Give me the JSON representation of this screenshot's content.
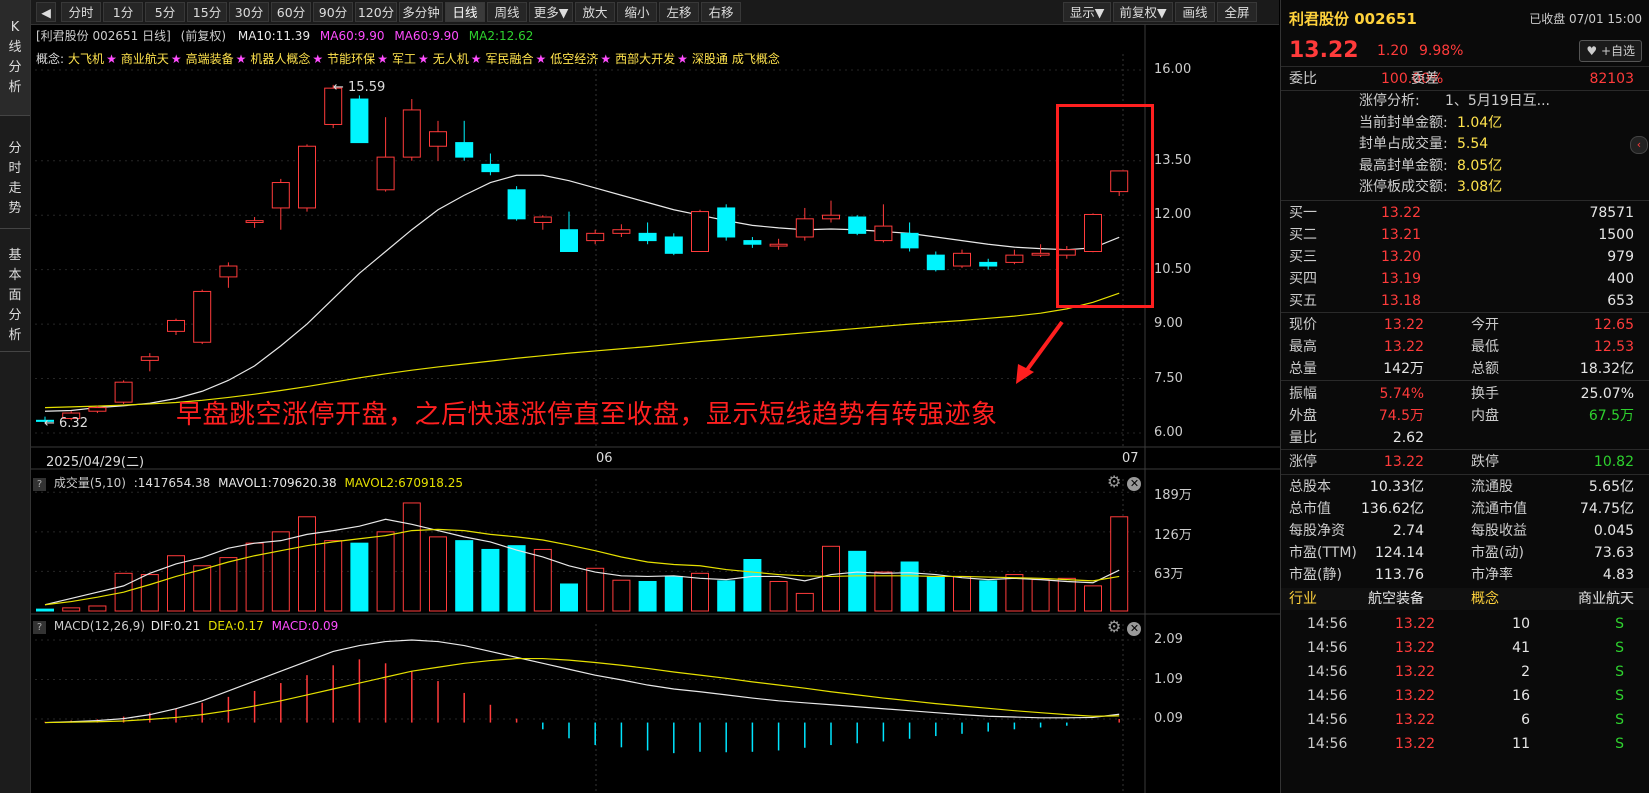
{
  "left_nav": [
    {
      "label": "K线分析"
    },
    {
      "label": "分时走势"
    },
    {
      "label": "基本面分析"
    }
  ],
  "toolbar": {
    "back_icon": "chevron-left-icon",
    "periods": [
      "分时",
      "1分",
      "5分",
      "15分",
      "30分",
      "60分",
      "90分",
      "120分",
      "多分钟",
      "日线",
      "周线",
      "更多▼"
    ],
    "active_period": "日线",
    "actions": [
      "放大",
      "缩小",
      "左移",
      "右移"
    ],
    "right_actions": [
      "显示▼",
      "前复权▼",
      "画线",
      "全屏"
    ]
  },
  "chart_header": {
    "stock_tag": "[利君股份 002651 日线]",
    "adj": "(前复权)",
    "ma10": "MA10:11.39",
    "ma60a": "MA60:9.90",
    "ma60b": "MA60:9.90",
    "ma2": "MA2:12.62"
  },
  "concepts": {
    "label": "概念:",
    "items": [
      "大飞机",
      "商业航天",
      "高端装备",
      "机器人概念",
      "节能环保",
      "军工",
      "无人机",
      "军民融合",
      "低空经济",
      "西部大开发",
      "深股通",
      "成飞概念"
    ],
    "star": "★"
  },
  "colors": {
    "up": "#ff3b3b",
    "down": "#00f5ff",
    "ma1": "#e8e8e8",
    "ma2": "#e5e000",
    "annotation": "#ff2020",
    "macd_neg": "#00e5ff"
  },
  "annotation": {
    "text": "早盘跳空涨停开盘，之后快速涨停直至收盘，显示短线趋势有转强迹象",
    "high_label": "15.59",
    "low_label": "6.32"
  },
  "volume_header": {
    "name": "成交量(5,10)",
    "vol": ":1417654.38",
    "mavol1": "MAVOL1:709620.38",
    "mavol2": "MAVOL2:670918.25"
  },
  "macd_header": {
    "name": "MACD(12,26,9)",
    "dif": "DIF:0.21",
    "dea": "DEA:0.17",
    "macd": "MACD:0.09"
  },
  "gear_icon": "gear-icon",
  "close_icon": "close-icon",
  "chart_data": [
    {
      "type": "candlestick",
      "title": "利君股份 002651 日线",
      "y_ticks": [
        "16.00",
        "13.50",
        "12.00",
        "10.50",
        "9.00",
        "7.50",
        "6.00"
      ],
      "x_labels": [
        "2025/04/29(二)",
        "06",
        "07"
      ],
      "ylim": [
        5.9,
        16.2
      ],
      "candles": [
        {
          "o": 6.35,
          "c": 6.32,
          "h": 6.45,
          "l": 6.3
        },
        {
          "o": 6.4,
          "c": 6.55,
          "h": 6.6,
          "l": 6.35
        },
        {
          "o": 6.6,
          "c": 6.7,
          "h": 6.75,
          "l": 6.55
        },
        {
          "o": 6.85,
          "c": 7.4,
          "h": 7.45,
          "l": 6.8
        },
        {
          "o": 8.0,
          "c": 8.1,
          "h": 8.2,
          "l": 7.7
        },
        {
          "o": 8.8,
          "c": 9.1,
          "h": 9.15,
          "l": 8.7
        },
        {
          "o": 8.5,
          "c": 9.9,
          "h": 9.95,
          "l": 8.45
        },
        {
          "o": 10.3,
          "c": 10.6,
          "h": 10.7,
          "l": 10.0
        },
        {
          "o": 11.8,
          "c": 11.85,
          "h": 11.95,
          "l": 11.65
        },
        {
          "o": 12.2,
          "c": 12.9,
          "h": 13.0,
          "l": 11.6
        },
        {
          "o": 12.2,
          "c": 13.9,
          "h": 13.95,
          "l": 12.1
        },
        {
          "o": 14.5,
          "c": 15.5,
          "h": 15.59,
          "l": 14.4
        },
        {
          "o": 15.2,
          "c": 14.0,
          "h": 15.3,
          "l": 14.0
        },
        {
          "o": 12.7,
          "c": 13.6,
          "h": 14.7,
          "l": 12.65
        },
        {
          "o": 13.6,
          "c": 14.9,
          "h": 15.2,
          "l": 13.5
        },
        {
          "o": 13.9,
          "c": 14.3,
          "h": 14.6,
          "l": 13.5
        },
        {
          "o": 14.0,
          "c": 13.6,
          "h": 14.6,
          "l": 13.5
        },
        {
          "o": 13.4,
          "c": 13.2,
          "h": 13.7,
          "l": 13.1
        },
        {
          "o": 12.7,
          "c": 11.9,
          "h": 12.8,
          "l": 11.85
        },
        {
          "o": 11.8,
          "c": 11.95,
          "h": 12.0,
          "l": 11.6
        },
        {
          "o": 11.6,
          "c": 11.0,
          "h": 12.1,
          "l": 11.0
        },
        {
          "o": 11.3,
          "c": 11.5,
          "h": 11.6,
          "l": 11.2
        },
        {
          "o": 11.5,
          "c": 11.6,
          "h": 11.75,
          "l": 11.4
        },
        {
          "o": 11.5,
          "c": 11.3,
          "h": 11.8,
          "l": 11.2
        },
        {
          "o": 11.4,
          "c": 10.95,
          "h": 11.5,
          "l": 10.9
        },
        {
          "o": 11.0,
          "c": 12.1,
          "h": 12.15,
          "l": 11.0
        },
        {
          "o": 12.2,
          "c": 11.4,
          "h": 12.3,
          "l": 11.3
        },
        {
          "o": 11.3,
          "c": 11.2,
          "h": 11.4,
          "l": 11.1
        },
        {
          "o": 11.15,
          "c": 11.2,
          "h": 11.35,
          "l": 11.05
        },
        {
          "o": 11.4,
          "c": 11.9,
          "h": 12.2,
          "l": 11.3
        },
        {
          "o": 11.9,
          "c": 12.0,
          "h": 12.4,
          "l": 11.8
        },
        {
          "o": 11.95,
          "c": 11.5,
          "h": 12.0,
          "l": 11.45
        },
        {
          "o": 11.3,
          "c": 11.7,
          "h": 12.3,
          "l": 11.25
        },
        {
          "o": 11.5,
          "c": 11.1,
          "h": 11.8,
          "l": 11.0
        },
        {
          "o": 10.9,
          "c": 10.5,
          "h": 11.0,
          "l": 10.45
        },
        {
          "o": 10.6,
          "c": 10.95,
          "h": 11.05,
          "l": 10.55
        },
        {
          "o": 10.7,
          "c": 10.6,
          "h": 10.8,
          "l": 10.5
        },
        {
          "o": 10.7,
          "c": 10.9,
          "h": 11.05,
          "l": 10.65
        },
        {
          "o": 10.9,
          "c": 10.95,
          "h": 11.2,
          "l": 10.85
        },
        {
          "o": 10.9,
          "c": 11.05,
          "h": 11.15,
          "l": 10.8
        },
        {
          "o": 11.0,
          "c": 12.02,
          "h": 12.05,
          "l": 10.98
        },
        {
          "o": 12.65,
          "c": 13.22,
          "h": 13.22,
          "l": 12.53
        }
      ],
      "ma_white": [
        6.6,
        6.62,
        6.7,
        6.75,
        6.82,
        6.95,
        7.15,
        7.45,
        7.85,
        8.4,
        9.0,
        9.7,
        10.4,
        11.0,
        11.6,
        12.15,
        12.55,
        12.9,
        13.1,
        13.1,
        12.95,
        12.75,
        12.55,
        12.35,
        12.15,
        12.0,
        11.85,
        11.72,
        11.65,
        11.6,
        11.62,
        11.6,
        11.55,
        11.5,
        11.4,
        11.3,
        11.2,
        11.12,
        11.08,
        11.05,
        11.1,
        11.39
      ],
      "ma_yellow": [
        6.7,
        6.72,
        6.74,
        6.77,
        6.8,
        6.84,
        6.9,
        6.98,
        7.07,
        7.17,
        7.28,
        7.4,
        7.52,
        7.63,
        7.73,
        7.82,
        7.9,
        7.98,
        8.06,
        8.13,
        8.2,
        8.26,
        8.32,
        8.38,
        8.45,
        8.52,
        8.58,
        8.64,
        8.7,
        8.76,
        8.82,
        8.88,
        8.94,
        9.0,
        9.05,
        9.1,
        9.16,
        9.22,
        9.3,
        9.42,
        9.6,
        9.85
      ]
    },
    {
      "type": "bar",
      "title": "成交量(5,10)",
      "y_ticks": [
        "189万",
        "126万",
        "63万"
      ],
      "ylim": [
        0,
        199
      ],
      "values": [
        3,
        5,
        8,
        60,
        58,
        88,
        72,
        85,
        108,
        126,
        150,
        112,
        108,
        126,
        172,
        118,
        112,
        98,
        104,
        98,
        43,
        68,
        49,
        47,
        55,
        60,
        48,
        82,
        47,
        28,
        103,
        95,
        62,
        78,
        55,
        55,
        48,
        58,
        50,
        52,
        40,
        150
      ],
      "mavol1": [
        10,
        20,
        30,
        40,
        60,
        75,
        85,
        100,
        108,
        112,
        122,
        128,
        135,
        146,
        138,
        128,
        118,
        110,
        97,
        86,
        72,
        62,
        56,
        55,
        56,
        52,
        50,
        55,
        55,
        48,
        58,
        62,
        60,
        61,
        58,
        53,
        50,
        52,
        50,
        47,
        45,
        65
      ],
      "mavol2": [
        10,
        15,
        22,
        30,
        42,
        55,
        66,
        78,
        88,
        96,
        104,
        110,
        115,
        120,
        128,
        130,
        128,
        122,
        118,
        113,
        105,
        96,
        86,
        78,
        74,
        72,
        66,
        62,
        58,
        56,
        55,
        56,
        56,
        56,
        55,
        55,
        54,
        53,
        52,
        50,
        48,
        55
      ]
    },
    {
      "type": "bar",
      "title": "MACD(12,26,9)",
      "y_ticks": [
        "2.09",
        "1.09",
        "0.09"
      ],
      "ylim": [
        -1.2,
        2.3
      ],
      "macd": [
        0.02,
        0.05,
        0.08,
        0.15,
        0.25,
        0.35,
        0.5,
        0.65,
        0.8,
        1.0,
        1.2,
        1.45,
        1.6,
        1.5,
        1.3,
        1.05,
        0.75,
        0.45,
        0.1,
        -0.15,
        -0.35,
        -0.5,
        -0.55,
        -0.62,
        -0.68,
        -0.65,
        -0.66,
        -0.65,
        -0.62,
        -0.56,
        -0.5,
        -0.46,
        -0.42,
        -0.36,
        -0.3,
        -0.25,
        -0.2,
        -0.15,
        -0.11,
        -0.07,
        0.0,
        0.09
      ],
      "dif": [
        0.0,
        0.02,
        0.05,
        0.1,
        0.2,
        0.35,
        0.55,
        0.8,
        1.05,
        1.3,
        1.55,
        1.8,
        1.95,
        2.05,
        2.09,
        2.05,
        1.95,
        1.8,
        1.65,
        1.5,
        1.35,
        1.2,
        1.08,
        0.95,
        0.85,
        0.78,
        0.7,
        0.62,
        0.55,
        0.5,
        0.45,
        0.4,
        0.35,
        0.3,
        0.25,
        0.2,
        0.16,
        0.14,
        0.12,
        0.12,
        0.13,
        0.21
      ],
      "dea": [
        0.0,
        0.01,
        0.02,
        0.04,
        0.08,
        0.13,
        0.2,
        0.3,
        0.42,
        0.55,
        0.7,
        0.85,
        1.0,
        1.15,
        1.3,
        1.4,
        1.5,
        1.57,
        1.62,
        1.62,
        1.58,
        1.52,
        1.45,
        1.37,
        1.28,
        1.2,
        1.12,
        1.03,
        0.95,
        0.87,
        0.78,
        0.7,
        0.62,
        0.55,
        0.48,
        0.42,
        0.36,
        0.3,
        0.25,
        0.2,
        0.16,
        0.17
      ]
    }
  ],
  "quote": {
    "name_code": "利君股份 002651",
    "status": "已收盘 07/01 15:00",
    "price": "13.22",
    "change": "1.20",
    "pct": "9.98%",
    "watch_label": "+自选",
    "weibi_label": "委比",
    "weibi": "100.00%",
    "weicha_label": "委差",
    "weicha": "82103",
    "limit": [
      {
        "k": "涨停分析:",
        "v": "1、5月19日互..."
      },
      {
        "k": "当前封单金额:",
        "v": "1.04亿"
      },
      {
        "k": "封单占成交量:",
        "v": "5.54"
      },
      {
        "k": "最高封单金额:",
        "v": "8.05亿"
      },
      {
        "k": "涨停板成交额:",
        "v": "3.08亿"
      }
    ],
    "bids": [
      {
        "k": "买一",
        "p": "13.22",
        "v": "78571"
      },
      {
        "k": "买二",
        "p": "13.21",
        "v": "1500"
      },
      {
        "k": "买三",
        "p": "13.20",
        "v": "979"
      },
      {
        "k": "买四",
        "p": "13.19",
        "v": "400"
      },
      {
        "k": "买五",
        "p": "13.18",
        "v": "653"
      }
    ],
    "stats1": [
      {
        "k1": "现价",
        "v1": "13.22",
        "c1": "red",
        "k2": "今开",
        "v2": "12.65",
        "c2": "red"
      },
      {
        "k1": "最高",
        "v1": "13.22",
        "c1": "red",
        "k2": "最低",
        "v2": "12.53",
        "c2": "red"
      },
      {
        "k1": "总量",
        "v1": "142万",
        "c1": "white",
        "k2": "总额",
        "v2": "18.32亿",
        "c2": "white"
      }
    ],
    "stats2": [
      {
        "k1": "振幅",
        "v1": "5.74%",
        "c1": "red",
        "k2": "换手",
        "v2": "25.07%",
        "c2": "white"
      },
      {
        "k1": "外盘",
        "v1": "74.5万",
        "c1": "red",
        "k2": "内盘",
        "v2": "67.5万",
        "c2": "green"
      },
      {
        "k1": "量比",
        "v1": "2.62",
        "c1": "white",
        "k2": "",
        "v2": "",
        "c2": "white"
      }
    ],
    "stats3": [
      {
        "k1": "涨停",
        "v1": "13.22",
        "c1": "red",
        "k2": "跌停",
        "v2": "10.82",
        "c2": "green"
      }
    ],
    "stats4": [
      {
        "k1": "总股本",
        "v1": "10.33亿",
        "c1": "white",
        "k2": "流通股",
        "v2": "5.65亿",
        "c2": "white"
      },
      {
        "k1": "总市值",
        "v1": "136.62亿",
        "c1": "white",
        "k2": "流通市值",
        "v2": "74.75亿",
        "c2": "white"
      },
      {
        "k1": "每股净资",
        "v1": "2.74",
        "c1": "white",
        "k2": "每股收益",
        "v2": "0.045",
        "c2": "white"
      },
      {
        "k1": "市盈(TTM)",
        "v1": "124.14",
        "c1": "white",
        "k2": "市盈(动)",
        "v2": "73.63",
        "c2": "white"
      },
      {
        "k1": "市盈(静)",
        "v1": "113.76",
        "c1": "white",
        "k2": "市净率",
        "v2": "4.83",
        "c2": "white"
      }
    ],
    "industry": {
      "k1": "行业",
      "v1": "航空装备",
      "k2": "概念",
      "v2": "商业航天"
    },
    "ticks": [
      {
        "t": "14:56",
        "p": "13.22",
        "v": "10",
        "d": "S"
      },
      {
        "t": "14:56",
        "p": "13.22",
        "v": "41",
        "d": "S"
      },
      {
        "t": "14:56",
        "p": "13.22",
        "v": "2",
        "d": "S"
      },
      {
        "t": "14:56",
        "p": "13.22",
        "v": "16",
        "d": "S"
      },
      {
        "t": "14:56",
        "p": "13.22",
        "v": "6",
        "d": "S"
      },
      {
        "t": "14:56",
        "p": "13.22",
        "v": "11",
        "d": "S"
      }
    ]
  }
}
